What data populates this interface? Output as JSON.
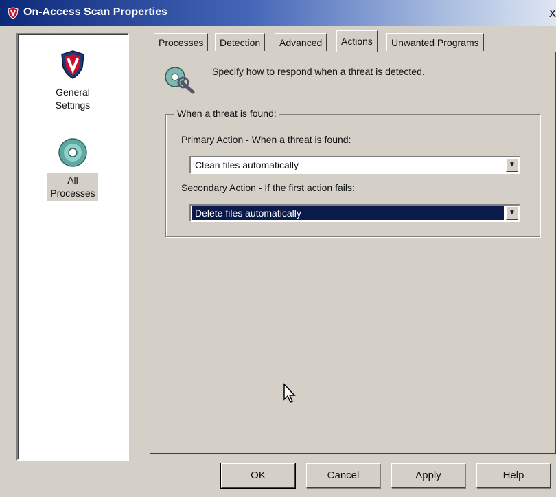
{
  "window": {
    "title": "On-Access Scan Properties",
    "close_glyph": "x"
  },
  "sidebar": {
    "items": [
      {
        "label": "General\nSettings",
        "icon": "mcafee-shield-icon"
      },
      {
        "label": "All\nProcesses",
        "icon": "disc-icon",
        "selected": true
      }
    ]
  },
  "tabs": [
    {
      "label": "Processes"
    },
    {
      "label": "Detection"
    },
    {
      "label": "Advanced"
    },
    {
      "label": "Actions",
      "active": true
    },
    {
      "label": "Unwanted Programs"
    }
  ],
  "actions": {
    "intro_text": "Specify how to respond when a threat is detected.",
    "group_title": "When a threat is found:",
    "primary_label": "Primary Action - When a threat is found:",
    "primary_value": "Clean files automatically",
    "secondary_label": "Secondary Action - If the first action fails:",
    "secondary_value": "Delete files automatically"
  },
  "buttons": {
    "ok": "OK",
    "cancel": "Cancel",
    "apply": "Apply",
    "help": "Help"
  },
  "colors": {
    "title_bar_start": "#0d2a7a",
    "face": "#d4d0c8",
    "selection": "#0a1a4a",
    "shield_red": "#c8102e"
  }
}
